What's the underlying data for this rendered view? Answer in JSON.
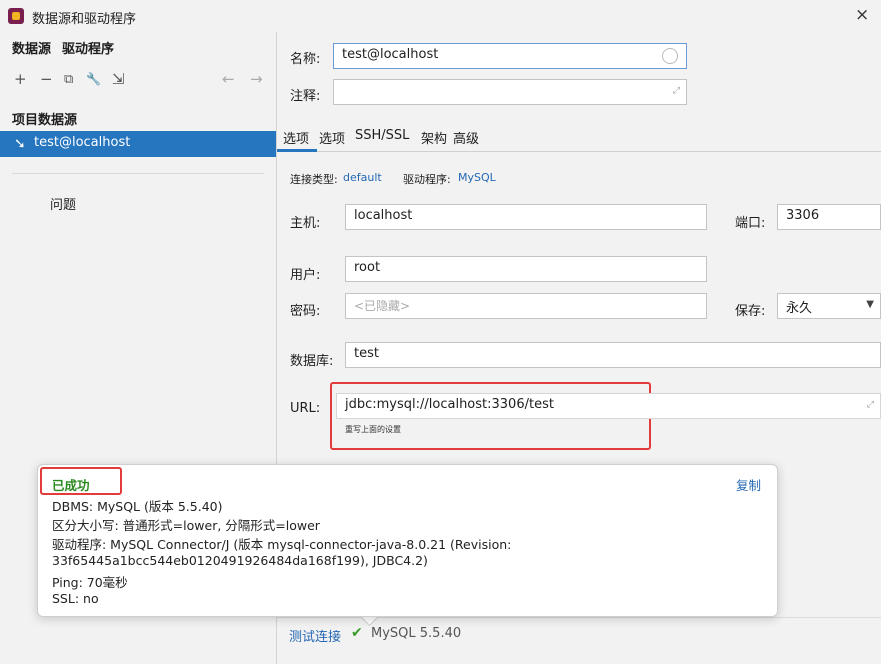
{
  "window": {
    "title": "数据源和驱动程序",
    "close_glyph": "×"
  },
  "left": {
    "tabs": [
      "数据源",
      "驱动程序"
    ],
    "toolbar": {
      "add": "+",
      "remove": "−",
      "duplicate": "⧉",
      "properties": "🔧",
      "import": "⇲",
      "back": "←",
      "forward": "→"
    },
    "group_title": "项目数据源",
    "datasource": "test@localhost",
    "problems": "问题"
  },
  "form": {
    "name_label": "名称:",
    "name_value": "test@localhost",
    "comment_label": "注释:",
    "comment_value": "",
    "tabs": [
      "选项",
      "选项",
      "SSH/SSL",
      "架构",
      "高级"
    ],
    "conn_type_label": "连接类型:",
    "conn_type_value": "default",
    "driver_label": "驱动程序:",
    "driver_value": "MySQL",
    "host_label": "主机:",
    "host_value": "localhost",
    "port_label": "端口:",
    "port_value": "3306",
    "user_label": "用户:",
    "user_value": "root",
    "password_label": "密码:",
    "password_placeholder": "<已隐藏>",
    "save_label": "保存:",
    "save_value": "永久",
    "database_label": "数据库:",
    "database_value": "test",
    "url_label": "URL:",
    "url_value": "jdbc:mysql://localhost:3306/test",
    "url_hint": "重写上面的设置"
  },
  "popup": {
    "status": "已成功",
    "copy": "复制",
    "lines": [
      "DBMS: MySQL (版本 5.5.40)",
      "区分大小写: 普通形式=lower, 分隔形式=lower",
      "驱动程序: MySQL Connector/J (版本 mysql-connector-java-8.0.21 (Revision:",
      "33f65445a1bcc544eb0120491926484da168f199), JDBC4.2)",
      "Ping: 70毫秒",
      "SSL: no"
    ]
  },
  "bottom": {
    "test_link": "测试连接",
    "check": "✔",
    "server_version": "MySQL 5.5.40"
  },
  "colors": {
    "accent": "#2675bf",
    "success": "#2a8a1f",
    "highlight": "#e23b3b"
  }
}
